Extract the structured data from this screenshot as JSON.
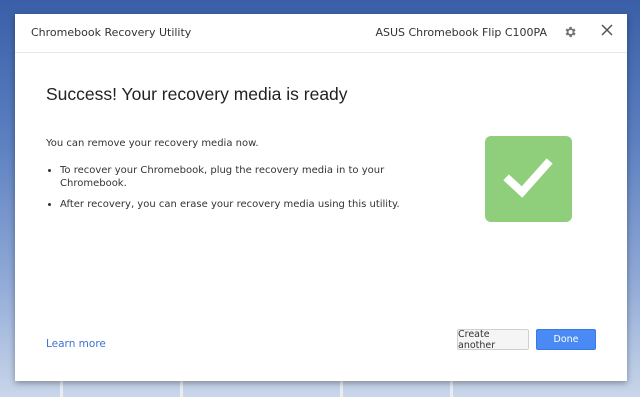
{
  "window": {
    "app_title": "Chromebook Recovery Utility",
    "device_name": "ASUS Chromebook Flip C100PA",
    "settings_icon": "gear-icon",
    "close_icon": "close-icon"
  },
  "content": {
    "heading": "Success! Your recovery media is ready",
    "intro": "You can remove your recovery media now.",
    "bullets": [
      "To recover your Chromebook, plug the recovery media in to your Chromebook.",
      "After recovery, you can erase your recovery media using this utility."
    ],
    "status_icon": "checkmark-icon",
    "status_color": "#8fce7a"
  },
  "footer": {
    "learn_more": "Learn more",
    "create_another": "Create another",
    "done": "Done"
  },
  "colors": {
    "accent": "#4a8af4",
    "link": "#3b73d6"
  }
}
